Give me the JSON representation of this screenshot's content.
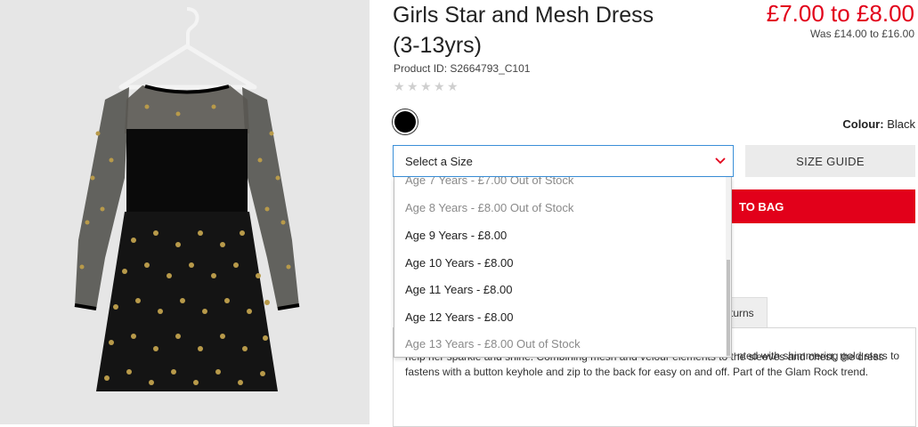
{
  "product": {
    "title": "Girls Star and Mesh Dress (3-13yrs)",
    "price": "£7.00 to £8.00",
    "was_price": "Was £14.00 to £16.00",
    "product_id": "Product ID: S2664793_C101",
    "rating_stars": 5,
    "rating_value": 0
  },
  "colour": {
    "label": "Colour:",
    "value": "Black",
    "swatch_color": "#000000"
  },
  "size_select": {
    "placeholder": "Select a Size",
    "options": [
      {
        "label": "Age 7 Years - £7.00 Out of Stock",
        "available": false
      },
      {
        "label": "Age 8 Years - £8.00 Out of Stock",
        "available": false
      },
      {
        "label": "Age 9 Years - £8.00",
        "available": true
      },
      {
        "label": "Age 10 Years - £8.00",
        "available": true
      },
      {
        "label": "Age 11 Years - £8.00",
        "available": true
      },
      {
        "label": "Age 12 Years - £8.00",
        "available": true
      },
      {
        "label": "Age 13 Years - £8.00 Out of Stock",
        "available": false
      }
    ]
  },
  "buttons": {
    "size_guide": "SIZE GUIDE",
    "add_to_bag": "TO BAG"
  },
  "tabs": {
    "returns": "turns"
  },
  "description": {
    "top_fragment": "nted with shimmering gold stars to",
    "body": "help her sparkle and shine. Combining mesh and velour elements to the sleeves and chest, the dress fastens with a button keyhole and zip to the back for easy on and off. Part of the Glam Rock trend."
  },
  "colors": {
    "price_red": "#e2001a",
    "focus_blue": "#3a8fd8"
  }
}
